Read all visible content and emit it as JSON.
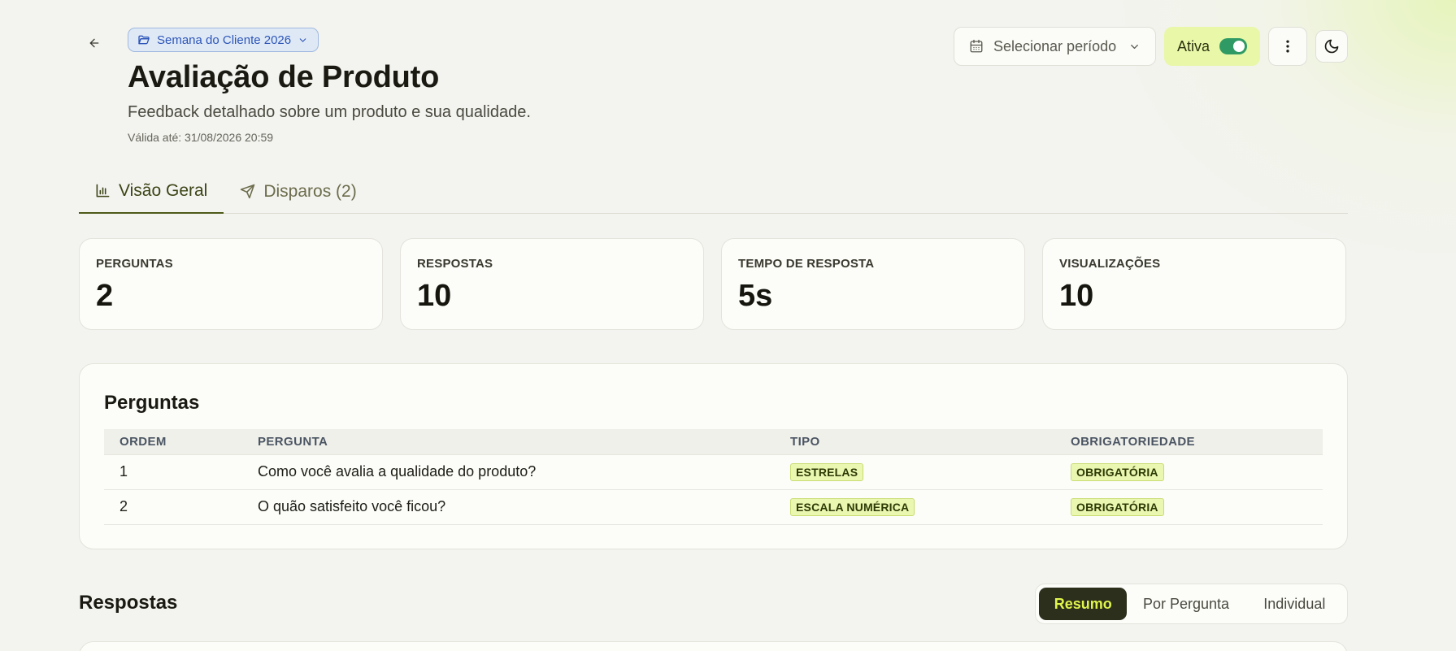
{
  "header": {
    "campaign": "Semana do Cliente 2026",
    "title": "Avaliação de Produto",
    "subtitle": "Feedback detalhado sobre um produto e sua qualidade.",
    "valid_until": "Válida até: 31/08/2026 20:59"
  },
  "actions": {
    "period_label": "Selecionar período",
    "status_label": "Ativa",
    "status_on": true
  },
  "tabs": [
    {
      "label": "Visão Geral",
      "active": true
    },
    {
      "label": "Disparos (2)",
      "active": false
    }
  ],
  "stats": [
    {
      "label": "PERGUNTAS",
      "value": "2"
    },
    {
      "label": "RESPOSTAS",
      "value": "10"
    },
    {
      "label": "TEMPO DE RESPOSTA",
      "value": "5s"
    },
    {
      "label": "VISUALIZAÇÕES",
      "value": "10"
    }
  ],
  "questions": {
    "title": "Perguntas",
    "columns": [
      "ORDEM",
      "PERGUNTA",
      "TIPO",
      "OBRIGATORIEDADE"
    ],
    "rows": [
      {
        "order": "1",
        "question": "Como você avalia a qualidade do produto?",
        "type": "ESTRELAS",
        "required": "OBRIGATÓRIA"
      },
      {
        "order": "2",
        "question": "O quão satisfeito você ficou?",
        "type": "ESCALA NUMÉRICA",
        "required": "OBRIGATÓRIA"
      }
    ]
  },
  "answers": {
    "title": "Respostas",
    "views": [
      "Resumo",
      "Por Pergunta",
      "Individual"
    ],
    "active_view": "Resumo"
  },
  "colors": {
    "accent": "#e8f7a8",
    "toggle_on": "#2f9a64",
    "segment_active_bg": "#2d2f1d",
    "segment_active_text": "#dff44d",
    "chip_text": "#2c55b8"
  }
}
